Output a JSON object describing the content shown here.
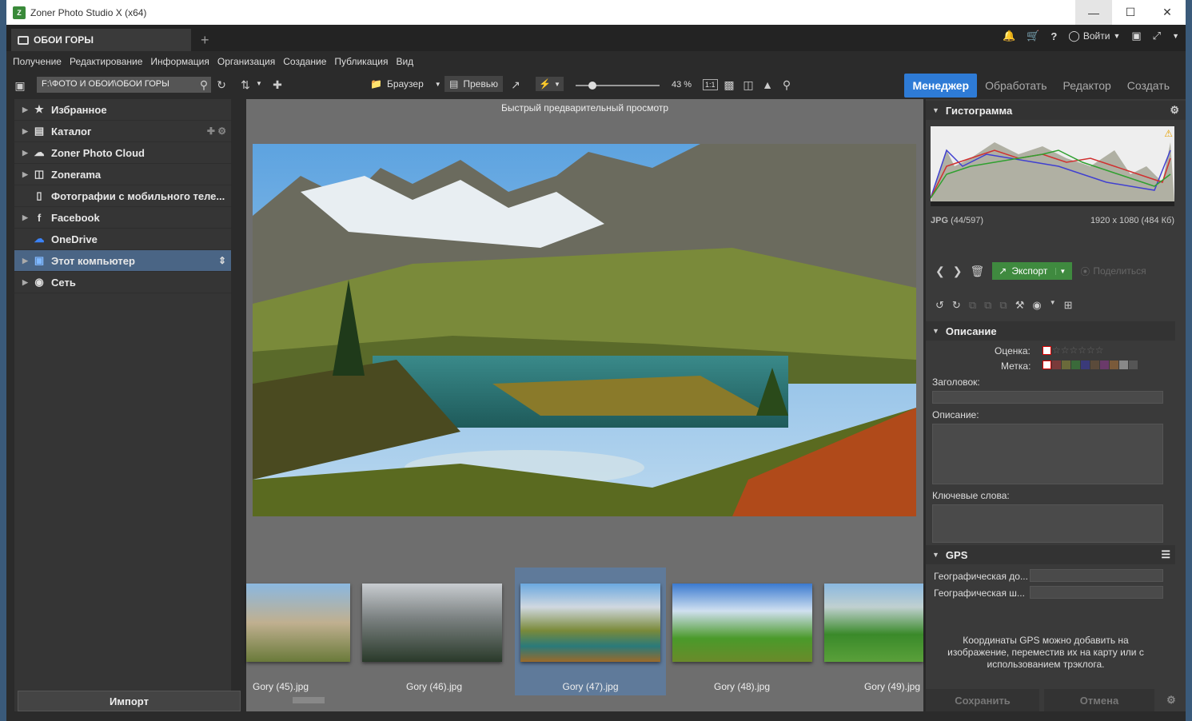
{
  "window": {
    "title": "Zoner Photo Studio X (x64)"
  },
  "tab": {
    "label": "ОБОИ ГОРЫ"
  },
  "account": {
    "login_label": "Войти"
  },
  "menu": [
    "Получение",
    "Редактирование",
    "Информация",
    "Организация",
    "Создание",
    "Публикация",
    "Вид"
  ],
  "toolbar": {
    "path": "F:\\ФОТО И ОБОИ\\ОБОИ ГОРЫ",
    "browser_label": "Браузер",
    "preview_label": "Превью",
    "zoom": "43 %",
    "ratio_label": "1:1"
  },
  "modes": [
    "Менеджер",
    "Обработать",
    "Редактор",
    "Создать"
  ],
  "nav": [
    {
      "label": "Избранное",
      "icon": "star-icon"
    },
    {
      "label": "Каталог",
      "icon": "catalog-icon"
    },
    {
      "label": "Zoner Photo Cloud",
      "icon": "cloud-icon"
    },
    {
      "label": "Zonerama",
      "icon": "zonerama-icon"
    },
    {
      "label": "Фотографии с мобильного теле...",
      "icon": "mobile-icon"
    },
    {
      "label": "Facebook",
      "icon": "facebook-icon"
    },
    {
      "label": "OneDrive",
      "icon": "onedrive-icon"
    },
    {
      "label": "Этот компьютер",
      "icon": "computer-icon"
    },
    {
      "label": "Сеть",
      "icon": "network-icon"
    }
  ],
  "import_label": "Импорт",
  "preview": {
    "caption": "Быстрый предварительный просмотр"
  },
  "thumbnails": [
    {
      "name": "Gory (45).jpg"
    },
    {
      "name": "Gory (46).jpg"
    },
    {
      "name": "Gory (47).jpg"
    },
    {
      "name": "Gory (48).jpg"
    },
    {
      "name": "Gory (49).jpg"
    }
  ],
  "right": {
    "histogram_title": "Гистограмма",
    "file_type": "JPG",
    "file_index": "(44/597)",
    "file_info": "1920 x 1080 (484 Кб)",
    "export_label": "Экспорт",
    "share_label": "Поделиться",
    "description_title": "Описание",
    "rating_label": "Оценка:",
    "label_label": "Метка:",
    "heading_label": "Заголовок:",
    "desc_label": "Описание:",
    "keywords_label": "Ключевые слова:",
    "gps_title": "GPS",
    "gps_lat": "Географическая до...",
    "gps_lon": "Географическая ш...",
    "gps_note": "Координаты GPS можно добавить на изображение, переместив их на карту или с использованием трэклога.",
    "save_label": "Сохранить",
    "cancel_label": "Отмена"
  },
  "colors": {
    "accent": "#2e7bd6",
    "export_green": "#3f8a3f",
    "selected_nav": "#4a6585"
  }
}
